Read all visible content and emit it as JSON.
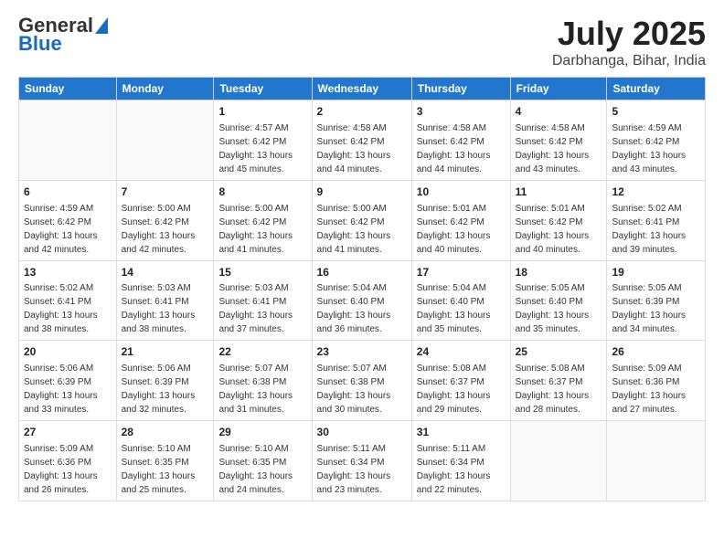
{
  "header": {
    "logo_general": "General",
    "logo_blue": "Blue",
    "main_title": "July 2025",
    "subtitle": "Darbhanga, Bihar, India"
  },
  "weekdays": [
    "Sunday",
    "Monday",
    "Tuesday",
    "Wednesday",
    "Thursday",
    "Friday",
    "Saturday"
  ],
  "weeks": [
    [
      {
        "day": "",
        "info": ""
      },
      {
        "day": "",
        "info": ""
      },
      {
        "day": "1",
        "info": "Sunrise: 4:57 AM\nSunset: 6:42 PM\nDaylight: 13 hours and 45 minutes."
      },
      {
        "day": "2",
        "info": "Sunrise: 4:58 AM\nSunset: 6:42 PM\nDaylight: 13 hours and 44 minutes."
      },
      {
        "day": "3",
        "info": "Sunrise: 4:58 AM\nSunset: 6:42 PM\nDaylight: 13 hours and 44 minutes."
      },
      {
        "day": "4",
        "info": "Sunrise: 4:58 AM\nSunset: 6:42 PM\nDaylight: 13 hours and 43 minutes."
      },
      {
        "day": "5",
        "info": "Sunrise: 4:59 AM\nSunset: 6:42 PM\nDaylight: 13 hours and 43 minutes."
      }
    ],
    [
      {
        "day": "6",
        "info": "Sunrise: 4:59 AM\nSunset: 6:42 PM\nDaylight: 13 hours and 42 minutes."
      },
      {
        "day": "7",
        "info": "Sunrise: 5:00 AM\nSunset: 6:42 PM\nDaylight: 13 hours and 42 minutes."
      },
      {
        "day": "8",
        "info": "Sunrise: 5:00 AM\nSunset: 6:42 PM\nDaylight: 13 hours and 41 minutes."
      },
      {
        "day": "9",
        "info": "Sunrise: 5:00 AM\nSunset: 6:42 PM\nDaylight: 13 hours and 41 minutes."
      },
      {
        "day": "10",
        "info": "Sunrise: 5:01 AM\nSunset: 6:42 PM\nDaylight: 13 hours and 40 minutes."
      },
      {
        "day": "11",
        "info": "Sunrise: 5:01 AM\nSunset: 6:42 PM\nDaylight: 13 hours and 40 minutes."
      },
      {
        "day": "12",
        "info": "Sunrise: 5:02 AM\nSunset: 6:41 PM\nDaylight: 13 hours and 39 minutes."
      }
    ],
    [
      {
        "day": "13",
        "info": "Sunrise: 5:02 AM\nSunset: 6:41 PM\nDaylight: 13 hours and 38 minutes."
      },
      {
        "day": "14",
        "info": "Sunrise: 5:03 AM\nSunset: 6:41 PM\nDaylight: 13 hours and 38 minutes."
      },
      {
        "day": "15",
        "info": "Sunrise: 5:03 AM\nSunset: 6:41 PM\nDaylight: 13 hours and 37 minutes."
      },
      {
        "day": "16",
        "info": "Sunrise: 5:04 AM\nSunset: 6:40 PM\nDaylight: 13 hours and 36 minutes."
      },
      {
        "day": "17",
        "info": "Sunrise: 5:04 AM\nSunset: 6:40 PM\nDaylight: 13 hours and 35 minutes."
      },
      {
        "day": "18",
        "info": "Sunrise: 5:05 AM\nSunset: 6:40 PM\nDaylight: 13 hours and 35 minutes."
      },
      {
        "day": "19",
        "info": "Sunrise: 5:05 AM\nSunset: 6:39 PM\nDaylight: 13 hours and 34 minutes."
      }
    ],
    [
      {
        "day": "20",
        "info": "Sunrise: 5:06 AM\nSunset: 6:39 PM\nDaylight: 13 hours and 33 minutes."
      },
      {
        "day": "21",
        "info": "Sunrise: 5:06 AM\nSunset: 6:39 PM\nDaylight: 13 hours and 32 minutes."
      },
      {
        "day": "22",
        "info": "Sunrise: 5:07 AM\nSunset: 6:38 PM\nDaylight: 13 hours and 31 minutes."
      },
      {
        "day": "23",
        "info": "Sunrise: 5:07 AM\nSunset: 6:38 PM\nDaylight: 13 hours and 30 minutes."
      },
      {
        "day": "24",
        "info": "Sunrise: 5:08 AM\nSunset: 6:37 PM\nDaylight: 13 hours and 29 minutes."
      },
      {
        "day": "25",
        "info": "Sunrise: 5:08 AM\nSunset: 6:37 PM\nDaylight: 13 hours and 28 minutes."
      },
      {
        "day": "26",
        "info": "Sunrise: 5:09 AM\nSunset: 6:36 PM\nDaylight: 13 hours and 27 minutes."
      }
    ],
    [
      {
        "day": "27",
        "info": "Sunrise: 5:09 AM\nSunset: 6:36 PM\nDaylight: 13 hours and 26 minutes."
      },
      {
        "day": "28",
        "info": "Sunrise: 5:10 AM\nSunset: 6:35 PM\nDaylight: 13 hours and 25 minutes."
      },
      {
        "day": "29",
        "info": "Sunrise: 5:10 AM\nSunset: 6:35 PM\nDaylight: 13 hours and 24 minutes."
      },
      {
        "day": "30",
        "info": "Sunrise: 5:11 AM\nSunset: 6:34 PM\nDaylight: 13 hours and 23 minutes."
      },
      {
        "day": "31",
        "info": "Sunrise: 5:11 AM\nSunset: 6:34 PM\nDaylight: 13 hours and 22 minutes."
      },
      {
        "day": "",
        "info": ""
      },
      {
        "day": "",
        "info": ""
      }
    ]
  ]
}
